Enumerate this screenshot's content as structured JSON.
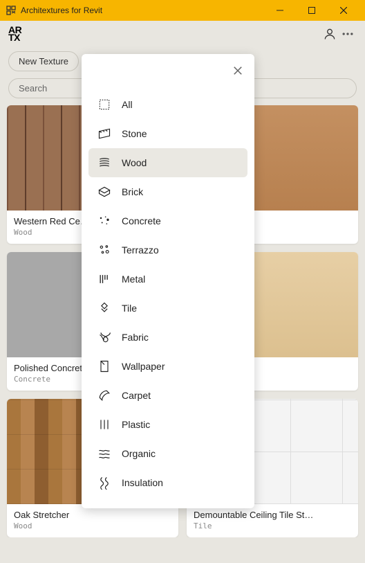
{
  "window": {
    "title": "Architextures for Revit"
  },
  "logo": {
    "line1": "AR",
    "line2": "TX"
  },
  "toolbar": {
    "new_texture": "New Texture",
    "search_placeholder": "Search"
  },
  "categories": {
    "selected": "Wood",
    "items": [
      {
        "label": "All",
        "icon": "all-icon"
      },
      {
        "label": "Stone",
        "icon": "stone-icon"
      },
      {
        "label": "Wood",
        "icon": "wood-icon"
      },
      {
        "label": "Brick",
        "icon": "brick-icon"
      },
      {
        "label": "Concrete",
        "icon": "concrete-icon"
      },
      {
        "label": "Terrazzo",
        "icon": "terrazzo-icon"
      },
      {
        "label": "Metal",
        "icon": "metal-icon"
      },
      {
        "label": "Tile",
        "icon": "tile-icon"
      },
      {
        "label": "Fabric",
        "icon": "fabric-icon"
      },
      {
        "label": "Wallpaper",
        "icon": "wallpaper-icon"
      },
      {
        "label": "Carpet",
        "icon": "carpet-icon"
      },
      {
        "label": "Plastic",
        "icon": "plastic-icon"
      },
      {
        "label": "Organic",
        "icon": "organic-icon"
      },
      {
        "label": "Insulation",
        "icon": "insulation-icon"
      }
    ]
  },
  "cards": [
    {
      "title": "Western Red Ce…",
      "subtitle": "Wood"
    },
    {
      "title": "",
      "subtitle": ""
    },
    {
      "title": "Polished Concret…",
      "subtitle": "Concrete"
    },
    {
      "title": "",
      "subtitle": ""
    },
    {
      "title": "Oak Stretcher",
      "subtitle": "Wood"
    },
    {
      "title": "Demountable Ceiling Tile St…",
      "subtitle": "Tile"
    }
  ]
}
